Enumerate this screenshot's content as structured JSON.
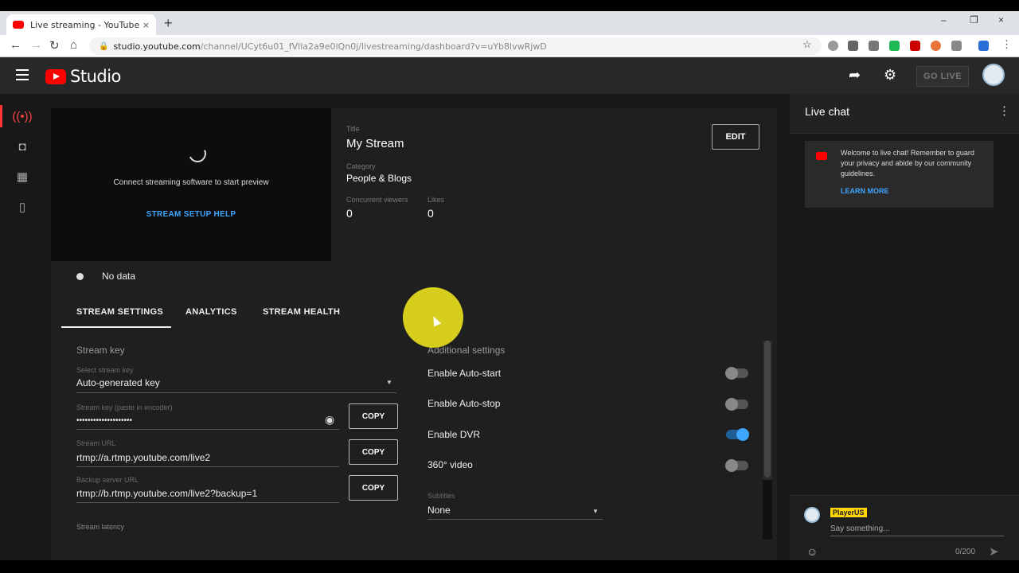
{
  "browser": {
    "tab_title": "Live streaming - YouTube Studio",
    "tab_close": "×",
    "new_tab": "+",
    "window_controls": [
      "–",
      "❐",
      "×"
    ],
    "url_host": "studio.youtube.com",
    "url_path": "/channel/UCyt6u01_fVlla2a9e0lQn0j/livestreaming/dashboard?v=uYb8lvwRjwD"
  },
  "header": {
    "logo_text": "Studio",
    "go_live": "GO LIVE"
  },
  "preview": {
    "message": "Connect streaming software to start preview",
    "setup_link": "STREAM SETUP HELP"
  },
  "stream_info": {
    "title_label": "Title",
    "title": "My Stream",
    "category_label": "Category",
    "category": "People & Blogs",
    "viewers_label": "Concurrent viewers",
    "viewers": "0",
    "likes_label": "Likes",
    "likes": "0",
    "edit_button": "EDIT"
  },
  "status": {
    "text": "No data"
  },
  "tabs": [
    "STREAM SETTINGS",
    "ANALYTICS",
    "STREAM HEALTH"
  ],
  "stream_key": {
    "heading": "Stream key",
    "select_label": "Select stream key",
    "select_value": "Auto-generated key",
    "key_label": "Stream key (paste in encoder)",
    "key_value": "••••••••••••••••••••",
    "url_label": "Stream URL",
    "url_value": "rtmp://a.rtmp.youtube.com/live2",
    "backup_label": "Backup server URL",
    "backup_value": "rtmp://b.rtmp.youtube.com/live2?backup=1",
    "copy": "COPY",
    "latency_label": "Stream latency"
  },
  "additional": {
    "heading": "Additional settings",
    "options": [
      {
        "label": "Enable Auto-start",
        "on": false
      },
      {
        "label": "Enable Auto-stop",
        "on": false
      },
      {
        "label": "Enable DVR",
        "on": true
      },
      {
        "label": "360° video",
        "on": false
      }
    ],
    "subtitles_label": "Subtitles",
    "subtitles_value": "None"
  },
  "chat": {
    "title": "Live chat",
    "welcome": "Welcome to live chat! Remember to guard your privacy and abide by our community guidelines.",
    "learn_more": "LEARN MORE",
    "username": "PlayerUS",
    "placeholder": "Say something...",
    "counter": "0/200"
  }
}
